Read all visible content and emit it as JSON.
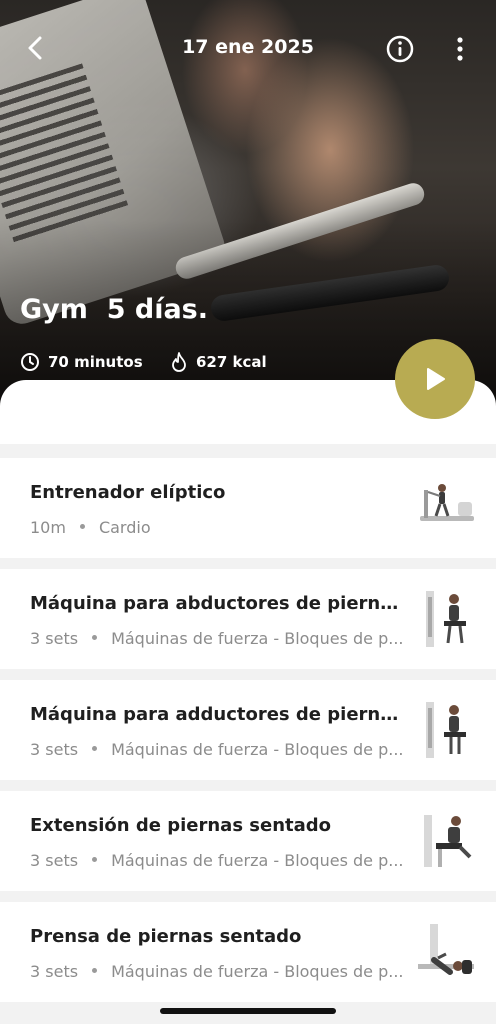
{
  "header": {
    "date": "17 ene 2025",
    "back_icon": "chevron-left-icon",
    "info_icon": "info-icon",
    "more_icon": "more-vertical-icon"
  },
  "workout": {
    "title": "Gym  5 días.",
    "duration": "70 minutos",
    "calories": "627 kcal"
  },
  "accent_color": "#b8ab52",
  "exercises": [
    {
      "name": "Entrenador elíptico",
      "detail": "10m",
      "category": "Cardio",
      "thumb_icon": "elliptical-trainer-icon"
    },
    {
      "name": "Máquina para abductores de piernas s...",
      "detail": "3 sets",
      "category": "Máquinas de fuerza - Bloques de p...",
      "thumb_icon": "hip-abductor-machine-icon"
    },
    {
      "name": "Máquina para adductores de piernas s...",
      "detail": "3 sets",
      "category": "Máquinas de fuerza - Bloques de p...",
      "thumb_icon": "hip-adductor-machine-icon"
    },
    {
      "name": "Extensión de piernas sentado",
      "detail": "3 sets",
      "category": "Máquinas de fuerza - Bloques de p...",
      "thumb_icon": "leg-extension-machine-icon"
    },
    {
      "name": "Prensa de piernas sentado",
      "detail": "3 sets",
      "category": "Máquinas de fuerza - Bloques de p...",
      "thumb_icon": "leg-press-machine-icon"
    }
  ]
}
